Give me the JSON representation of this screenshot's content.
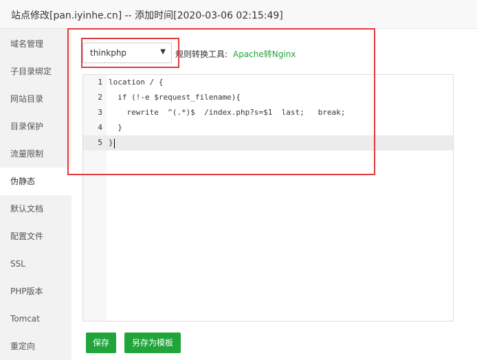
{
  "window": {
    "title": "站点修改[pan.iyinhe.cn] -- 添加时间[2020-03-06 02:15:49]"
  },
  "sidebar": {
    "items": [
      {
        "label": "域名管理"
      },
      {
        "label": "子目录绑定"
      },
      {
        "label": "网站目录"
      },
      {
        "label": "目录保护"
      },
      {
        "label": "流量限制"
      },
      {
        "label": "伪静态",
        "active": true
      },
      {
        "label": "默认文档"
      },
      {
        "label": "配置文件"
      },
      {
        "label": "SSL"
      },
      {
        "label": "PHP版本"
      },
      {
        "label": "Tomcat"
      },
      {
        "label": "重定向"
      }
    ]
  },
  "rewrite": {
    "template_select": {
      "selected": "thinkphp"
    },
    "tools_label": "规则转换工具:",
    "tools_link": "Apache转Nginx"
  },
  "editor": {
    "lines": [
      {
        "num": "1",
        "text": "location / {"
      },
      {
        "num": "2",
        "text": "  if (!-e $request_filename){"
      },
      {
        "num": "3",
        "text": "    rewrite  ^(.*)$  /index.php?s=$1  last;   break;"
      },
      {
        "num": "4",
        "text": "  }"
      },
      {
        "num": "5",
        "text": "}"
      }
    ]
  },
  "buttons": {
    "save": "保存",
    "save_as_template": "另存为模板"
  },
  "colors": {
    "accent": "#20a53a",
    "highlight_box": "#e0393e"
  }
}
